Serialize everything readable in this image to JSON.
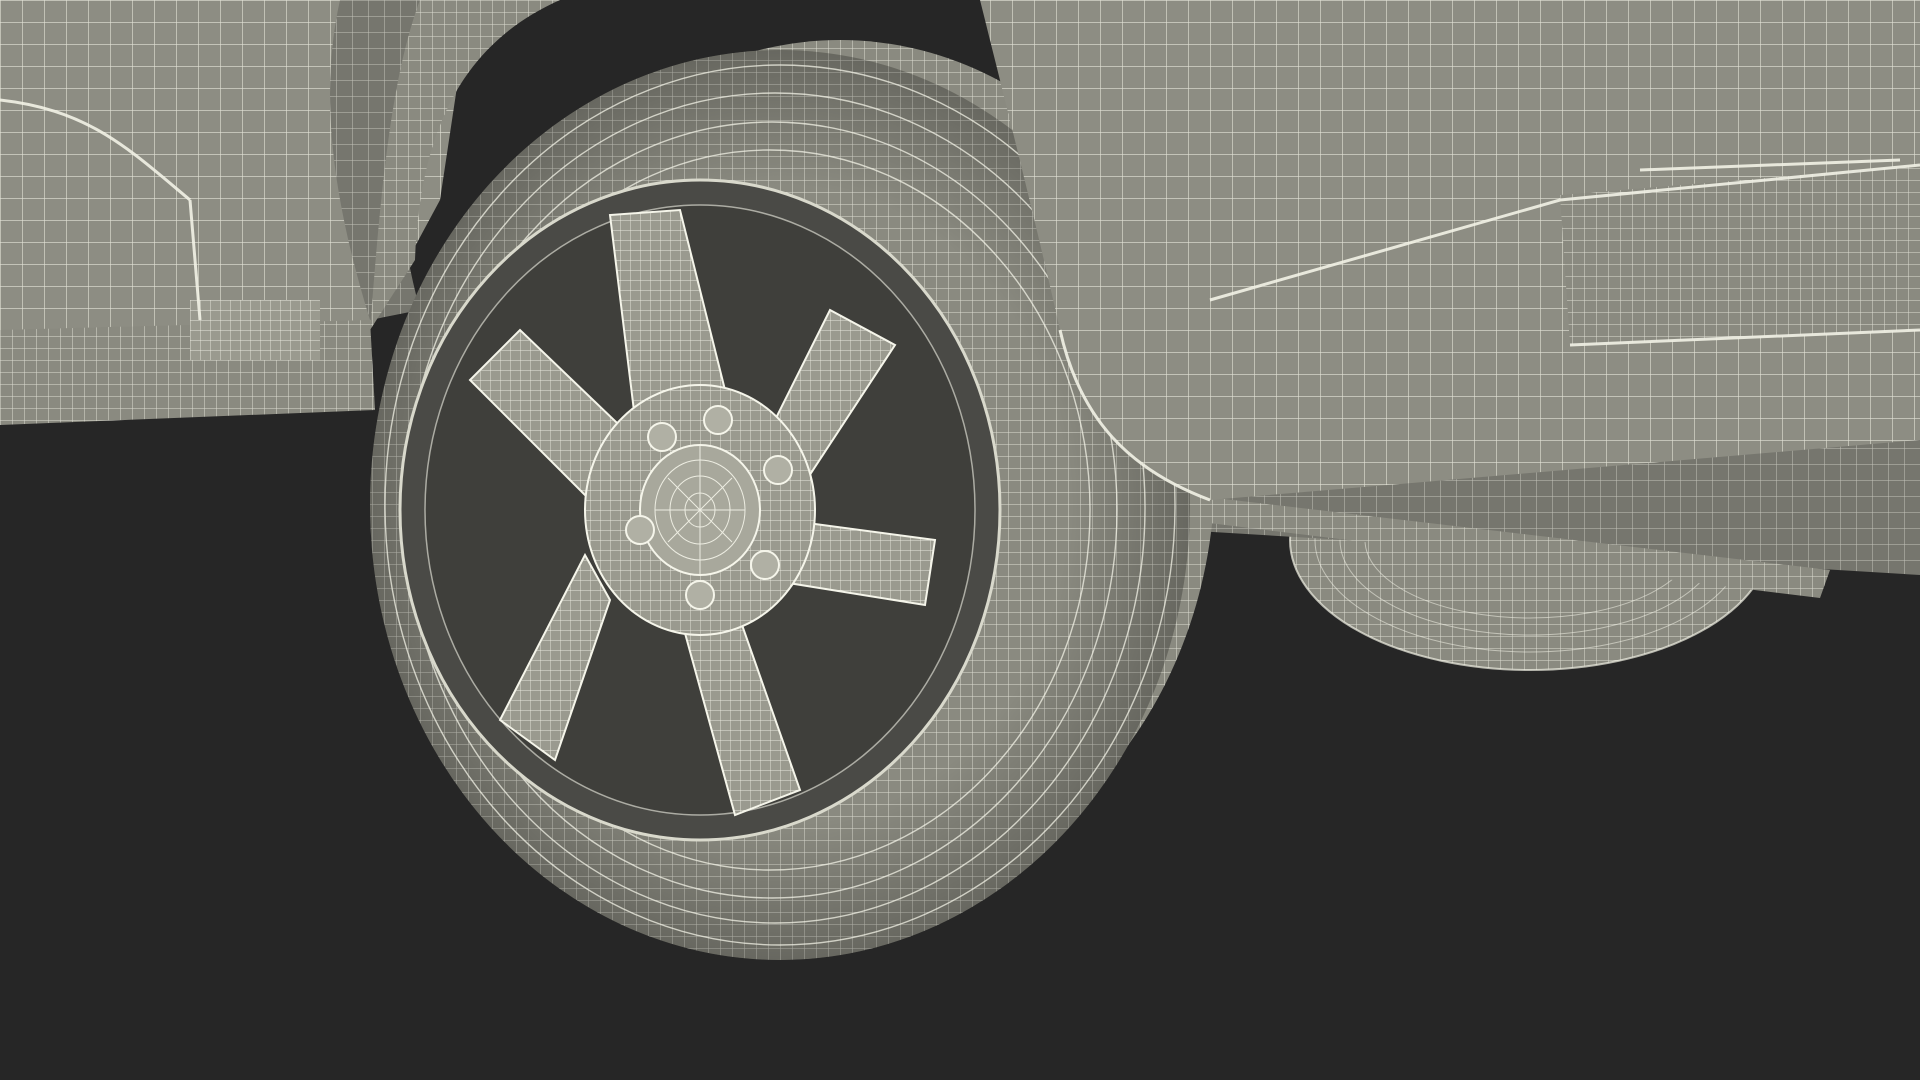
{
  "scene": {
    "subject": "wireframe-vehicle-wheel",
    "colors": {
      "background": "#262626",
      "surface": "#8a8a80",
      "surface_light": "#a3a398",
      "surface_dark": "#6e6e66",
      "wire": "#f2f2e6",
      "rim_dark": "#4a4a46",
      "shadow": "#3a3a37"
    },
    "wheel": {
      "spoke_count": 6,
      "lug_nut_count": 6
    }
  }
}
